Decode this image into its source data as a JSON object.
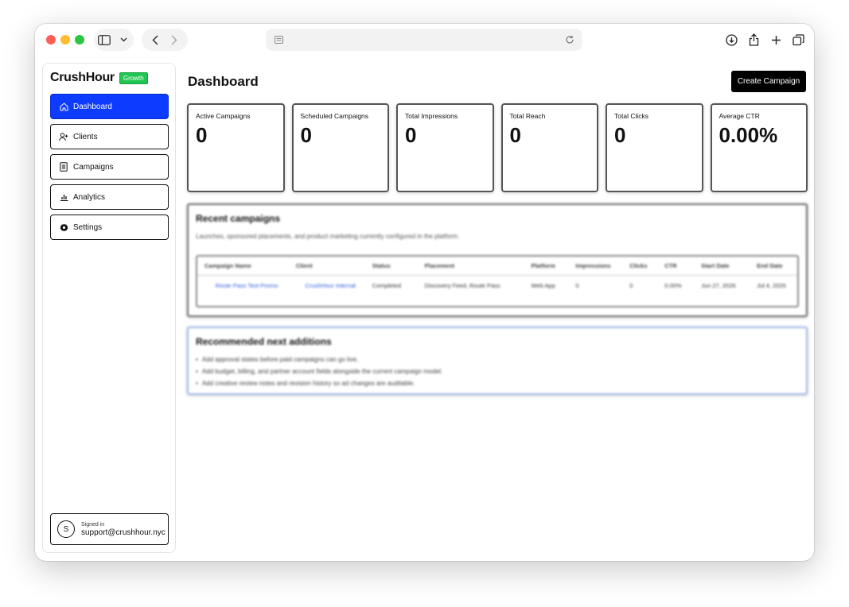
{
  "browser": {
    "icons": [
      "sidebar-icon",
      "chevron-down-icon",
      "back-icon",
      "forward-icon",
      "reader-icon",
      "reload-icon",
      "download-icon",
      "share-icon",
      "new-tab-icon",
      "tabs-icon"
    ]
  },
  "brand": {
    "name": "CrushHour",
    "badge": "Growth"
  },
  "nav": {
    "items": [
      {
        "label": "Dashboard",
        "icon": "home-icon",
        "active": true
      },
      {
        "label": "Clients",
        "icon": "user-plus-icon"
      },
      {
        "label": "Campaigns",
        "icon": "document-icon"
      },
      {
        "label": "Analytics",
        "icon": "bar-chart-icon"
      },
      {
        "label": "Settings",
        "icon": "gear-icon"
      }
    ]
  },
  "user": {
    "initial": "S",
    "label": "Signed in",
    "email": "support@crushhour.nyc"
  },
  "page": {
    "title": "Dashboard",
    "create_button": "Create Campaign"
  },
  "stats": [
    {
      "label": "Active Campaigns",
      "value": "0"
    },
    {
      "label": "Scheduled Campaigns",
      "value": "0"
    },
    {
      "label": "Total Impressions",
      "value": "0"
    },
    {
      "label": "Total Reach",
      "value": "0"
    },
    {
      "label": "Total Clicks",
      "value": "0"
    },
    {
      "label": "Average CTR",
      "value": "0.00%"
    }
  ],
  "recent": {
    "title": "Recent campaigns",
    "description": "Launches, sponsored placements, and product marketing currently configured in the platform.",
    "columns": [
      "Campaign Name",
      "Client",
      "Status",
      "Placement",
      "Platform",
      "Impressions",
      "Clicks",
      "CTR",
      "Start Date",
      "End Date"
    ],
    "rows": [
      [
        "Route Pass Test Promo",
        "CrushHour Internal",
        "Completed",
        "Discovery Feed, Route Pass",
        "Web App",
        "0",
        "0",
        "0.00%",
        "Jun 27, 2026",
        "Jul 4, 2026"
      ]
    ]
  },
  "recommend": {
    "title": "Recommended next additions",
    "items": [
      "Add approval states before paid campaigns can go live.",
      "Add budget, billing, and partner account fields alongside the current campaign model.",
      "Add creative review notes and revision history so ad changes are auditable."
    ]
  },
  "colors": {
    "accent": "#0d3bff",
    "badge": "#23c552",
    "link": "#2c5ddc"
  }
}
